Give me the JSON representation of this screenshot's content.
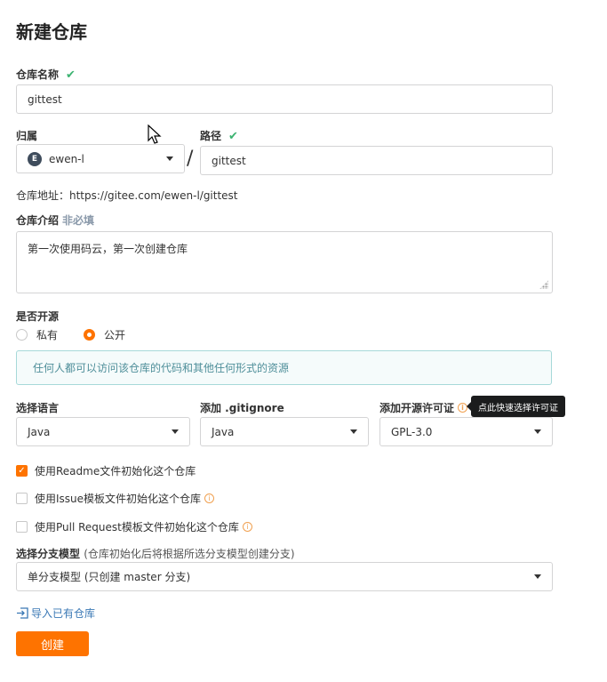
{
  "page": {
    "title": "新建仓库"
  },
  "repo_name": {
    "label": "仓库名称",
    "value": "gittest"
  },
  "owner": {
    "label": "归属",
    "avatar_letter": "E",
    "value": "ewen-l"
  },
  "path": {
    "label": "路径",
    "separator": "/",
    "value": "gittest"
  },
  "repo_address": {
    "text": "仓库地址：https://gitee.com/ewen-l/gittest"
  },
  "description": {
    "label": "仓库介绍",
    "optional": "非必填",
    "value": "第一次使用码云，第一次创建仓库"
  },
  "visibility": {
    "label": "是否开源",
    "options": [
      "私有",
      "公开"
    ],
    "selected": "公开",
    "info": "任何人都可以访问该仓库的代码和其他任何形式的资源"
  },
  "language": {
    "label": "选择语言",
    "value": "Java"
  },
  "gitignore": {
    "label": "添加 .gitignore",
    "value": "Java"
  },
  "license": {
    "label": "添加开源许可证",
    "value": "GPL-3.0",
    "tooltip": "点此快速选择许可证"
  },
  "init_options": [
    {
      "label": "使用Readme文件初始化这个仓库",
      "checked": true
    },
    {
      "label": "使用Issue模板文件初始化这个仓库",
      "checked": false
    },
    {
      "label": "使用Pull Request模板文件初始化这个仓库",
      "checked": false
    }
  ],
  "branch_model": {
    "label": "选择分支模型",
    "note": "(仓库初始化后将根据所选分支模型创建分支)",
    "value": "单分支模型 (只创建 master 分支)"
  },
  "import_link": {
    "label": "导入已有仓库"
  },
  "submit": {
    "label": "创建"
  },
  "icons": {
    "check": "check-icon",
    "help": "info-circle-icon",
    "caret": "caret-down-icon",
    "import": "import-icon",
    "cursor": "mouse-pointer-icon"
  },
  "colors": {
    "accent": "#fe7300",
    "success": "#3cb371",
    "info_bg": "#f5fbfb",
    "link": "#3a78b5"
  }
}
